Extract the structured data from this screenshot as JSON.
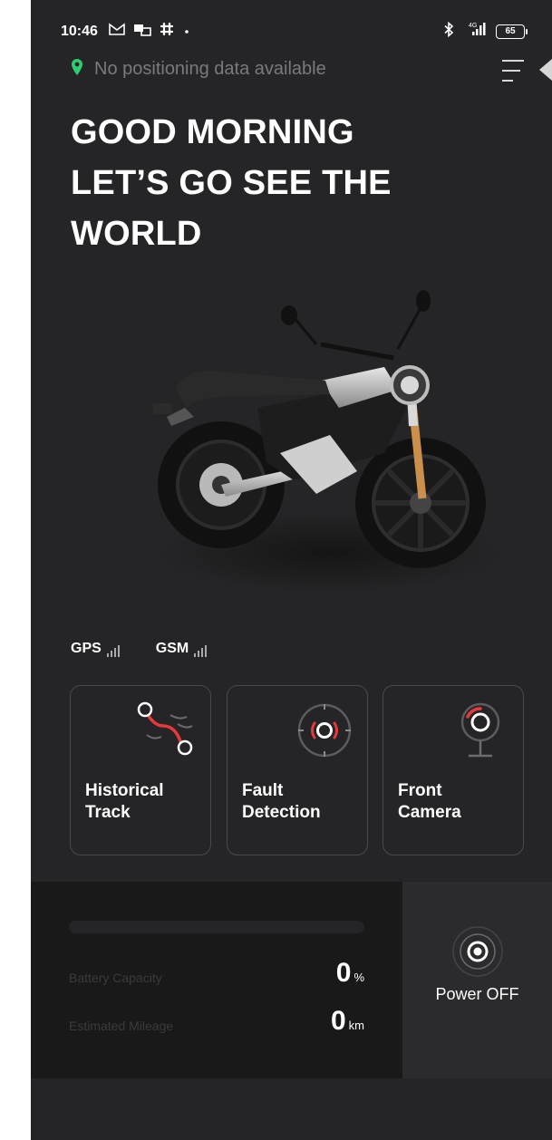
{
  "status_bar": {
    "time": "10:46",
    "notification_icons": [
      "gmail-icon",
      "message-icon",
      "slack-icon",
      "dot-icon"
    ],
    "right_icons": [
      "bluetooth-icon",
      "cellular-4g-icon"
    ],
    "battery_level": "65"
  },
  "location": {
    "text": "No positioning data available",
    "icon": "location-pin-icon",
    "icon_color": "#2ecc71"
  },
  "menu": {
    "icon": "menu-icon"
  },
  "greeting": {
    "line1": "GOOD MORNING",
    "line2": "LET’S GO SEE THE",
    "line3": "WORLD"
  },
  "signals": [
    {
      "label": "GPS",
      "icon": "signal-bars-icon"
    },
    {
      "label": "GSM",
      "icon": "signal-bars-icon"
    }
  ],
  "features": [
    {
      "line1": "Historical",
      "line2": "Track",
      "icon": "route-icon"
    },
    {
      "line1": "Fault",
      "line2": "Detection",
      "icon": "diagnostics-icon"
    },
    {
      "line1": "Front",
      "line2": "Camera",
      "icon": "camera-icon"
    }
  ],
  "vehicle": {
    "battery_label": "Battery Capacity",
    "battery_value": "0",
    "battery_unit": "%",
    "battery_fill_percent": 0,
    "mileage_label": "Estimated Mileage",
    "mileage_value": "0",
    "mileage_unit": "km"
  },
  "power": {
    "label": "Power OFF",
    "icon": "power-icon"
  },
  "colors": {
    "background": "#252527",
    "accent_red": "#e63a3a",
    "location_green": "#2ecc71"
  }
}
